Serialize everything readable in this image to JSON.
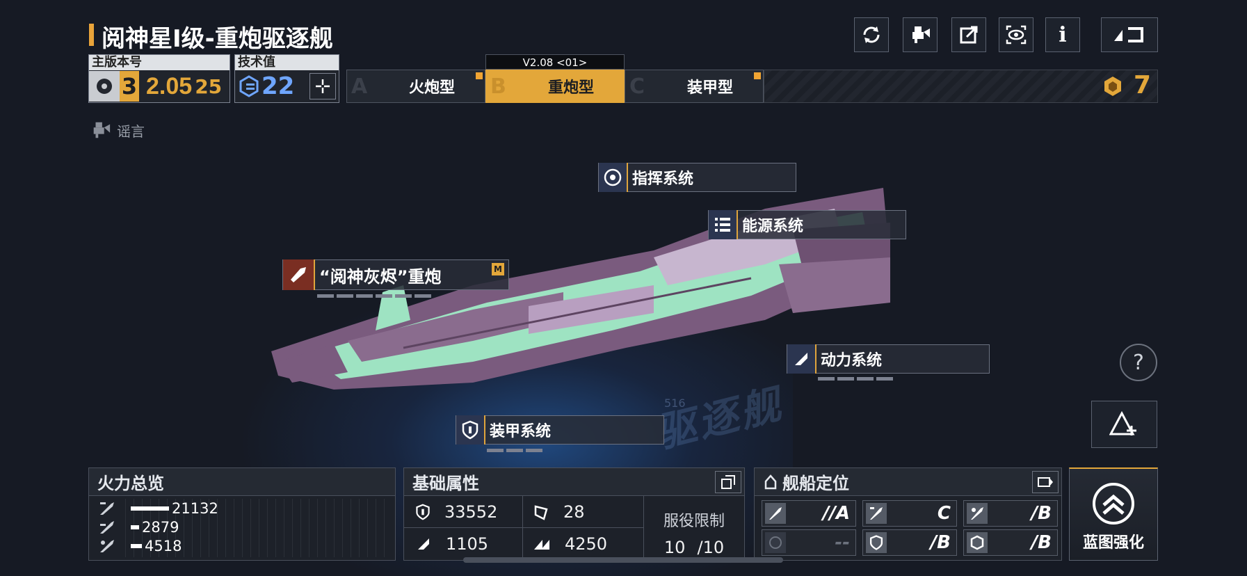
{
  "header": {
    "title": "阅神星Ⅰ级-重炮驱逐舰"
  },
  "version_box": {
    "label": "主版本号",
    "level": "3",
    "version": "2.05",
    "sub": "25"
  },
  "tech_box": {
    "label": "技术值",
    "value": "22"
  },
  "tabs": [
    {
      "letter": "A",
      "label": "火炮型",
      "active": false
    },
    {
      "letter": "B",
      "label": "重炮型",
      "active": true,
      "version_tag": "V2.08 <01>"
    },
    {
      "letter": "C",
      "label": "装甲型",
      "active": false
    }
  ],
  "currency": {
    "value": "7"
  },
  "rumor": {
    "label": "谣言"
  },
  "systems": {
    "command": "指挥系统",
    "energy": "能源系统",
    "weapon": "“阅神灰烬”重炮",
    "weapon_badge": "M",
    "power": "动力系统",
    "armor": "装甲系统"
  },
  "watermark": {
    "text": "驱逐舰",
    "num": "516"
  },
  "firepower": {
    "title": "火力总览",
    "rows": [
      {
        "value": "21132",
        "fraction": 0.55
      },
      {
        "value": "2879",
        "fraction": 0.12
      },
      {
        "value": "4518",
        "fraction": 0.16
      }
    ]
  },
  "base_stats": {
    "title": "基础属性",
    "hp": "33552",
    "armor": "28",
    "shield": "1105",
    "speed": "4250",
    "service_label": "服役限制",
    "service_cur": "10",
    "service_max": "/10"
  },
  "positioning": {
    "title": "舰船定位",
    "cells": [
      "//A",
      "C",
      "/B",
      "--",
      "/B",
      "/B"
    ]
  },
  "upgrade": {
    "label": "蓝图强化"
  },
  "colors": {
    "accent": "#e3a73a",
    "bg": "#161a24",
    "panel": "#1d2129"
  },
  "icons": [
    "refresh-icon",
    "rumor-icon",
    "share-icon",
    "eye-icon",
    "info-icon",
    "back-icon"
  ]
}
